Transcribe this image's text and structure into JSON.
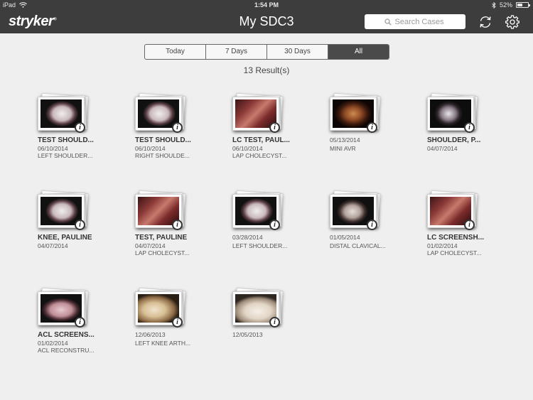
{
  "status_bar": {
    "device": "iPad",
    "time": "1:54 PM",
    "battery": "52%"
  },
  "nav": {
    "logo": "stryker",
    "title": "My SDC3",
    "search_placeholder": "Search Cases"
  },
  "filters": {
    "tabs": [
      "Today",
      "7 Days",
      "30 Days",
      "All"
    ],
    "selected": "All"
  },
  "results_label": "13 Result(s)",
  "cases": [
    {
      "title": "TEST SHOULD...",
      "date": "06/10/2014",
      "procedure": "LEFT SHOULDER...",
      "image": "arthroscopy-light"
    },
    {
      "title": "TEST SHOULD...",
      "date": "06/10/2014",
      "procedure": "RIGHT SHOULDE...",
      "image": "arthroscopy-light"
    },
    {
      "title": "LC TEST, PAUL...",
      "date": "06/10/2014",
      "procedure": "LAP CHOLECYST...",
      "image": "laparoscopy-red"
    },
    {
      "title": "",
      "date": "05/13/2014",
      "procedure": "MINI AVR",
      "image": "cardiac-brown"
    },
    {
      "title": "SHOULDER, P...",
      "date": "04/07/2014",
      "procedure": "",
      "image": "arthroscopy-dark"
    },
    {
      "title": "KNEE, PAULINE",
      "date": "04/07/2014",
      "procedure": "",
      "image": "arthroscopy-light"
    },
    {
      "title": "TEST, PAULINE",
      "date": "04/07/2014",
      "procedure": "LAP CHOLECYST...",
      "image": "laparoscopy-red"
    },
    {
      "title": "",
      "date": "03/28/2014",
      "procedure": "LEFT SHOULDER...",
      "image": "arthroscopy-light"
    },
    {
      "title": "",
      "date": "01/05/2014",
      "procedure": "DISTAL CLAVICAL...",
      "image": "arthroscopy-tool"
    },
    {
      "title": "LC SCREENSH...",
      "date": "01/02/2014",
      "procedure": "LAP CHOLECYST...",
      "image": "laparoscopy-red"
    },
    {
      "title": "ACL SCREENS...",
      "date": "01/02/2014",
      "procedure": "ACL RECONSTRU...",
      "image": "arthroscopy-pink"
    },
    {
      "title": "",
      "date": "12/06/2013",
      "procedure": "LEFT KNEE ARTH...",
      "image": "knee-cartilage"
    },
    {
      "title": "",
      "date": "12/05/2013",
      "procedure": "",
      "image": "knee-cartilage-pale"
    }
  ],
  "icons": {
    "search": "search-icon",
    "sync": "sync-icon",
    "settings": "gear-icon",
    "info": "info-icon",
    "wifi": "wifi-icon",
    "bluetooth": "bluetooth-icon"
  },
  "colors": {
    "navbar": "#3d3d3d",
    "background": "#efefef",
    "segment_active": "#4a4a4a"
  }
}
